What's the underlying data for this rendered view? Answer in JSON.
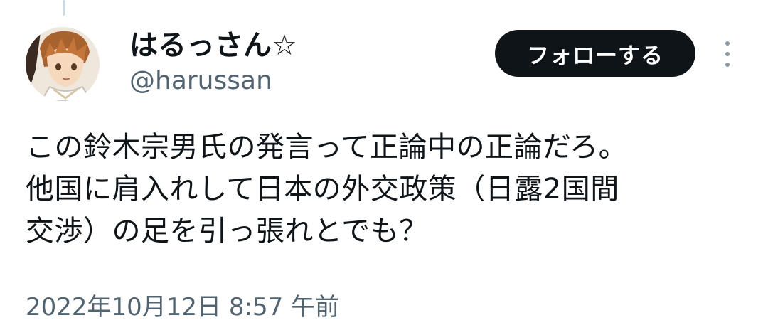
{
  "tweet": {
    "author": {
      "display_name": "はるっさん☆",
      "handle": "@harussan",
      "avatar_icon": "anime-character-avatar-icon"
    },
    "follow_label": "フォローする",
    "more_icon": "more-vertical-icon",
    "text_lines": [
      "この鈴木宗男氏の発言って正論中の正論だろ。",
      "他国に肩入れして日本の外交政策（日露2国間",
      "交渉）の足を引っ張れとでも？"
    ],
    "timestamp": "2022年10月12日 8:57 午前"
  },
  "colors": {
    "follow_bg": "#0f1419",
    "secondary_text": "#536471",
    "thread_line": "#cfd9de"
  }
}
